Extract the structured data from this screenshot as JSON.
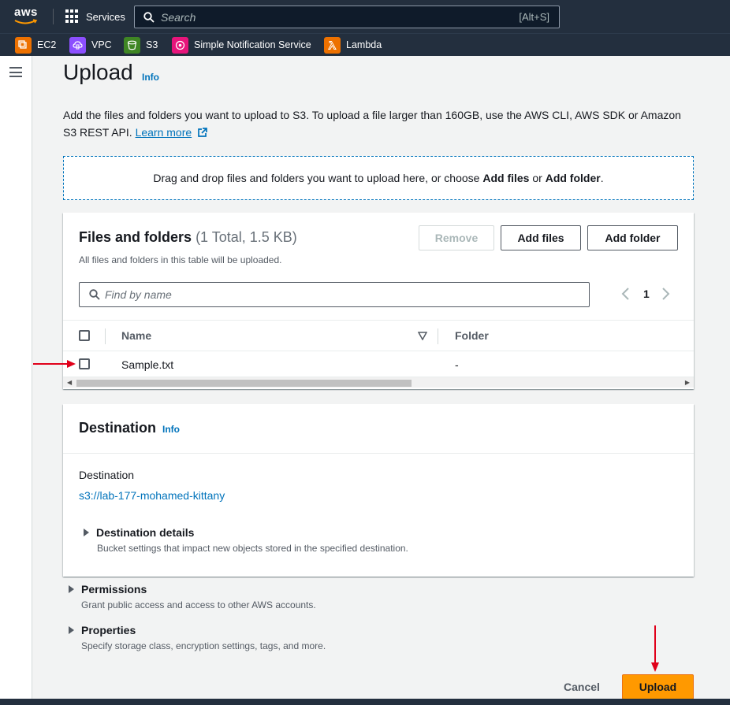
{
  "topbar": {
    "logo": "aws",
    "services_label": "Services",
    "search_placeholder": "Search",
    "search_shortcut": "[Alt+S]"
  },
  "favorites": [
    {
      "label": "EC2",
      "icon": "ec2-icon",
      "color": "#ed7100"
    },
    {
      "label": "VPC",
      "icon": "vpc-icon",
      "color": "#8c4fff"
    },
    {
      "label": "S3",
      "icon": "s3-icon",
      "color": "#3f8624"
    },
    {
      "label": "Simple Notification Service",
      "icon": "sns-icon",
      "color": "#e7157b"
    },
    {
      "label": "Lambda",
      "icon": "lambda-icon",
      "color": "#ed7100"
    }
  ],
  "page": {
    "title": "Upload",
    "info": "Info",
    "description": "Add the files and folders you want to upload to S3. To upload a file larger than 160GB, use the AWS CLI, AWS SDK or Amazon S3 REST API.",
    "learn_more": "Learn more",
    "dropzone_prefix": "Drag and drop files and folders you want to upload here, or choose ",
    "dropzone_add_files": "Add files",
    "dropzone_or": " or ",
    "dropzone_add_folder": "Add folder",
    "dropzone_suffix": "."
  },
  "files": {
    "title": "Files and folders",
    "count": "(1 Total, 1.5 KB)",
    "subtitle": "All files and folders in this table will be uploaded.",
    "remove_label": "Remove",
    "add_files_label": "Add files",
    "add_folder_label": "Add folder",
    "filter_placeholder": "Find by name",
    "page_number": "1",
    "columns": [
      "Name",
      "Folder"
    ],
    "rows": [
      {
        "name": "Sample.txt",
        "folder": "-"
      }
    ]
  },
  "destination": {
    "title": "Destination",
    "info": "Info",
    "label": "Destination",
    "uri": "s3://lab-177-mohamed-kittany",
    "details_title": "Destination details",
    "details_sub": "Bucket settings that impact new objects stored in the specified destination."
  },
  "permissions": {
    "title": "Permissions",
    "sub": "Grant public access and access to other AWS accounts."
  },
  "properties": {
    "title": "Properties",
    "sub": "Specify storage class, encryption settings, tags, and more."
  },
  "footer": {
    "cancel_label": "Cancel",
    "upload_label": "Upload"
  },
  "colors": {
    "nav_bg": "#232f3e",
    "link": "#0073bb",
    "primary": "#ff9900",
    "annotation_arrow": "#e0001a"
  }
}
